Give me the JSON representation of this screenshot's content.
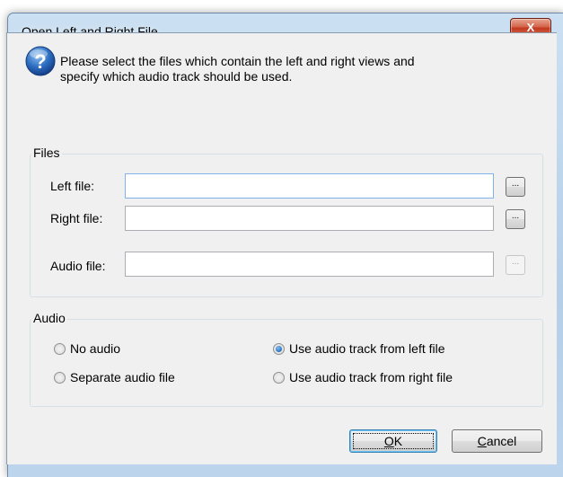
{
  "window": {
    "title": "Open Left and Right File",
    "close_glyph": "X"
  },
  "message": {
    "icon": "question-icon",
    "text": "Please select the files which contain the left and right views and specify which audio track should be used."
  },
  "files_group": {
    "title": "Files",
    "left_label": "Left file:",
    "left_value": "",
    "right_label": "Right file:",
    "right_value": "",
    "audio_label": "Audio file:",
    "audio_value": "",
    "browse_label": "..."
  },
  "audio_group": {
    "title": "Audio",
    "options": [
      {
        "label": "No audio",
        "checked": false
      },
      {
        "label": "Separate audio file",
        "checked": false
      },
      {
        "label": "Use audio track from left file",
        "checked": true
      },
      {
        "label": "Use audio track from right file",
        "checked": false
      }
    ]
  },
  "buttons": {
    "ok_mnemonic": "O",
    "ok_rest": "K",
    "cancel_mnemonic": "C",
    "cancel_rest": "ancel"
  },
  "colors": {
    "title_bar": "#bcd5ec",
    "close_button": "#c2391f",
    "dialog_background": "#f0f0f0",
    "focus_border": "#7eb4ea"
  }
}
